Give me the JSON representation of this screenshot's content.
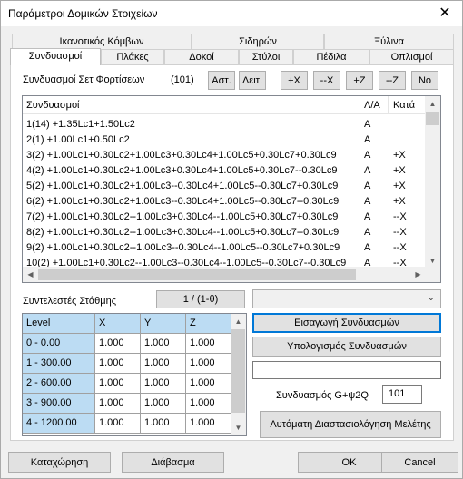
{
  "window": {
    "title": "Παράμετροι Δομικών Στοιχείων",
    "close_glyph": "✕"
  },
  "tabs": {
    "row1": [
      "Ικανοτικός Κόμβων",
      "Σιδηρών",
      "Ξύλινα"
    ],
    "row2": [
      "Συνδυασμοί",
      "Πλάκες",
      "Δοκοί",
      "Στύλοι",
      "Πέδιλα",
      "Οπλισμοί"
    ]
  },
  "sets": {
    "label": "Συνδυασμοί Σετ Φορτίσεων",
    "count": "(101)",
    "buttons": [
      "Αστ.",
      "Λειτ.",
      "+X",
      "--X",
      "+Z",
      "--Z",
      "No"
    ]
  },
  "list": {
    "headers": [
      "Συνδυασμοί",
      "Λ/Α",
      "Κατά"
    ],
    "rows": [
      [
        "1(14) +1.35Lc1+1.50Lc2",
        "A",
        ""
      ],
      [
        "2(1) +1.00Lc1+0.50Lc2",
        "A",
        ""
      ],
      [
        "3(2) +1.00Lc1+0.30Lc2+1.00Lc3+0.30Lc4+1.00Lc5+0.30Lc7+0.30Lc9",
        "A",
        "+X"
      ],
      [
        "4(2) +1.00Lc1+0.30Lc2+1.00Lc3+0.30Lc4+1.00Lc5+0.30Lc7--0.30Lc9",
        "A",
        "+X"
      ],
      [
        "5(2) +1.00Lc1+0.30Lc2+1.00Lc3--0.30Lc4+1.00Lc5--0.30Lc7+0.30Lc9",
        "A",
        "+X"
      ],
      [
        "6(2) +1.00Lc1+0.30Lc2+1.00Lc3--0.30Lc4+1.00Lc5--0.30Lc7--0.30Lc9",
        "A",
        "+X"
      ],
      [
        "7(2) +1.00Lc1+0.30Lc2--1.00Lc3+0.30Lc4--1.00Lc5+0.30Lc7+0.30Lc9",
        "A",
        "--X"
      ],
      [
        "8(2) +1.00Lc1+0.30Lc2--1.00Lc3+0.30Lc4--1.00Lc5+0.30Lc7--0.30Lc9",
        "A",
        "--X"
      ],
      [
        "9(2) +1.00Lc1+0.30Lc2--1.00Lc3--0.30Lc4--1.00Lc5--0.30Lc7+0.30Lc9",
        "A",
        "--X"
      ],
      [
        "10(2) +1.00Lc1+0.30Lc2--1.00Lc3--0.30Lc4--1.00Lc5--0.30Lc7--0.30Lc9",
        "A",
        "--X"
      ]
    ]
  },
  "coeffs": {
    "label": "Συντελεστές Στάθμης",
    "button": "1 / (1-θ)"
  },
  "grid": {
    "headers": [
      "Level",
      "X",
      "Y",
      "Z"
    ],
    "rows": [
      [
        "0 - 0.00",
        "1.000",
        "1.000",
        "1.000"
      ],
      [
        "1 - 300.00",
        "1.000",
        "1.000",
        "1.000"
      ],
      [
        "2 - 600.00",
        "1.000",
        "1.000",
        "1.000"
      ],
      [
        "3 - 900.00",
        "1.000",
        "1.000",
        "1.000"
      ],
      [
        "4 - 1200.00",
        "1.000",
        "1.000",
        "1.000"
      ]
    ]
  },
  "right": {
    "combo_value": "",
    "insert_btn": "Εισαγωγή Συνδυασμών",
    "calc_btn": "Υπολογισμός Συνδυασμών",
    "text_value": "",
    "g_label": "Συνδυασμός G+ψ2Q",
    "g_value": "101",
    "auto_btn": "Αυτόματη Διαστασιολόγηση Μελέτης"
  },
  "footer": {
    "save": "Καταχώρηση",
    "read": "Διάβασμα",
    "ok": "OK",
    "cancel": "Cancel"
  }
}
